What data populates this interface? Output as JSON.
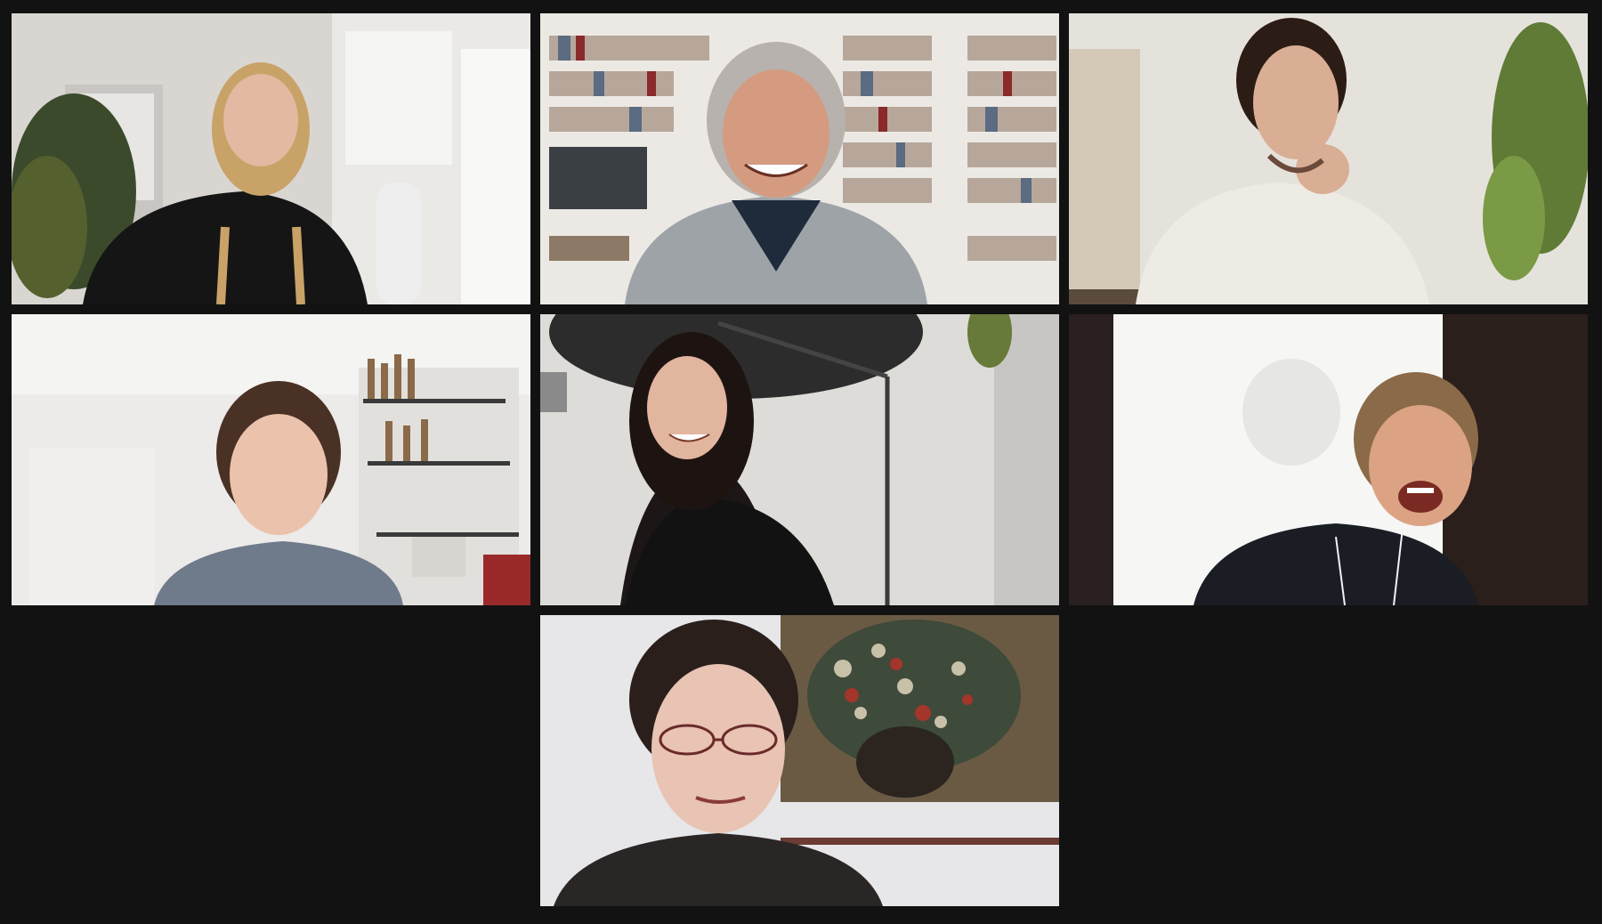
{
  "app": {
    "view": "gallery-view"
  },
  "participants": [
    {
      "role": "participant",
      "video": "on",
      "speaking": false
    },
    {
      "role": "participant",
      "video": "on",
      "speaking": false
    },
    {
      "role": "participant",
      "video": "on",
      "speaking": false
    },
    {
      "role": "participant",
      "video": "on",
      "speaking": false
    },
    {
      "role": "participant",
      "video": "on",
      "speaking": false
    },
    {
      "role": "participant",
      "video": "on",
      "speaking": false
    },
    {
      "role": "participant",
      "video": "on",
      "speaking": false
    }
  ],
  "colors": {
    "background": "#121212",
    "tile_border": "#121212"
  }
}
